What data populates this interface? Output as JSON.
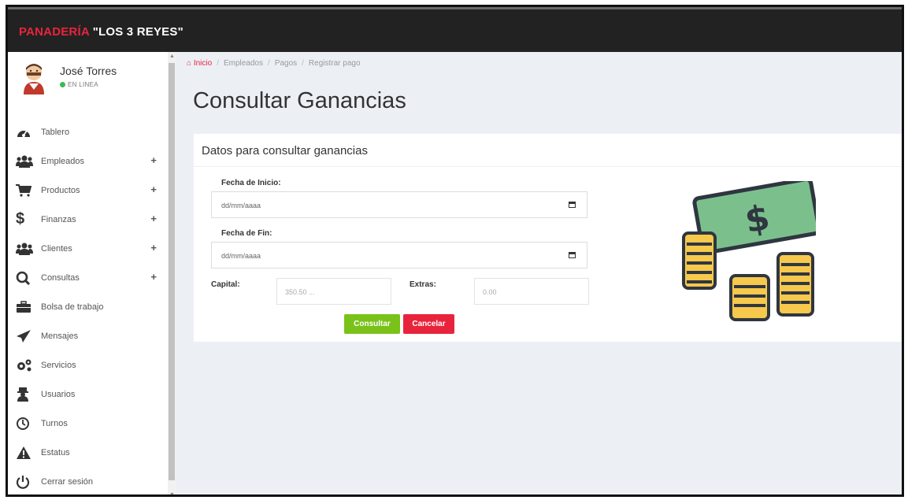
{
  "app": {
    "brand_red": "PANADERÍA",
    "brand_white": "\"LOS 3 REYES\""
  },
  "user": {
    "name": "José Torres",
    "status": "EN LINEA"
  },
  "sidebar": {
    "items": [
      {
        "label": "Tablero",
        "icon": "dashboard-icon",
        "expandable": false
      },
      {
        "label": "Empleados",
        "icon": "users-icon",
        "expandable": true
      },
      {
        "label": "Productos",
        "icon": "cart-icon",
        "expandable": true
      },
      {
        "label": "Finanzas",
        "icon": "dollar-icon",
        "expandable": true
      },
      {
        "label": "Clientes",
        "icon": "users-icon",
        "expandable": true
      },
      {
        "label": "Consultas",
        "icon": "search-icon",
        "expandable": true
      },
      {
        "label": "Bolsa de trabajo",
        "icon": "briefcase-icon",
        "expandable": false
      },
      {
        "label": "Mensajes",
        "icon": "paper-plane-icon",
        "expandable": false
      },
      {
        "label": "Servicios",
        "icon": "gears-icon",
        "expandable": false
      },
      {
        "label": "Usuarios",
        "icon": "user-secret-icon",
        "expandable": false
      },
      {
        "label": "Turnos",
        "icon": "clock-icon",
        "expandable": false
      },
      {
        "label": "Estatus",
        "icon": "warning-icon",
        "expandable": false
      },
      {
        "label": "Cerrar sesión",
        "icon": "power-icon",
        "expandable": false
      }
    ],
    "plus_symbol": "+"
  },
  "breadcrumb": {
    "items": [
      "Inicio",
      "Empleados",
      "Pagos",
      "Registrar pago"
    ],
    "home_icon": "⌂"
  },
  "page": {
    "title": "Consultar Ganancias"
  },
  "form": {
    "card_title": "Datos para consultar ganancias",
    "fecha_inicio_label": "Fecha de Inicio:",
    "fecha_inicio_value": "dd/mm/aaaa",
    "fecha_fin_label": "Fecha de Fin:",
    "fecha_fin_value": "dd/mm/aaaa",
    "capital_label": "Capital:",
    "capital_placeholder": "350.50 ...",
    "extras_label": "Extras:",
    "extras_placeholder": "0.00",
    "consultar_label": "Consultar",
    "cancelar_label": "Cancelar"
  },
  "colors": {
    "accent_red": "#e8243c",
    "success_green": "#7ac21a",
    "topbar": "#222222"
  }
}
